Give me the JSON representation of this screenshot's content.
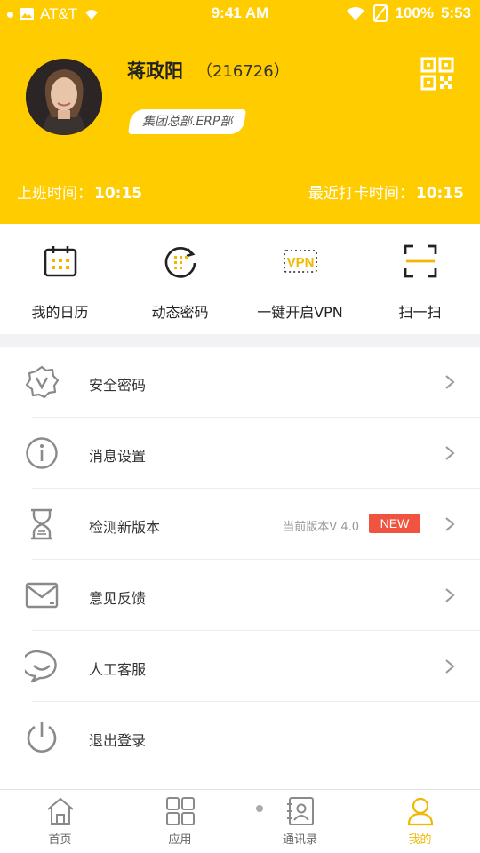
{
  "status_bar": {
    "carrier": "AT&T",
    "time": "9:41 AM",
    "battery": "100%",
    "overlay_time": "5:53"
  },
  "profile": {
    "name": "蒋政阳",
    "employee_id": "（216726）",
    "department": "集团总部.ERP部"
  },
  "attendance": {
    "work_start_label": "上班时间：",
    "work_start_value": "10:15",
    "last_punch_label": "最近打卡时间：",
    "last_punch_value": "10:15"
  },
  "quick_actions": [
    {
      "label": "我的日历",
      "icon": "calendar-icon"
    },
    {
      "label": "动态密码",
      "icon": "dynamic-password-icon"
    },
    {
      "label": "一键开启VPN",
      "icon": "vpn-icon",
      "icon_text": "VPN"
    },
    {
      "label": "扫一扫",
      "icon": "scan-icon"
    }
  ],
  "menu": [
    {
      "label": "安全密码",
      "icon": "shield-badge-icon"
    },
    {
      "label": "消息设置",
      "icon": "info-icon"
    },
    {
      "label": "检测新版本",
      "icon": "hourglass-icon",
      "version_text": "当前版本V 4.0",
      "badge": "NEW"
    },
    {
      "label": "意见反馈",
      "icon": "mail-icon"
    },
    {
      "label": "人工客服",
      "icon": "chat-bubble-icon"
    },
    {
      "label": "退出登录",
      "icon": "power-icon"
    }
  ],
  "tabs": [
    {
      "label": "首页",
      "icon": "home-icon",
      "active": false
    },
    {
      "label": "应用",
      "icon": "apps-grid-icon",
      "active": false
    },
    {
      "label": "通讯录",
      "icon": "contacts-icon",
      "active": false
    },
    {
      "label": "我的",
      "icon": "person-icon",
      "active": true
    }
  ],
  "colors": {
    "brand_yellow": "#FFCC00",
    "active_tab": "#F0B800",
    "new_badge": "#F0533F",
    "icon_gray": "#8a8a8a"
  }
}
